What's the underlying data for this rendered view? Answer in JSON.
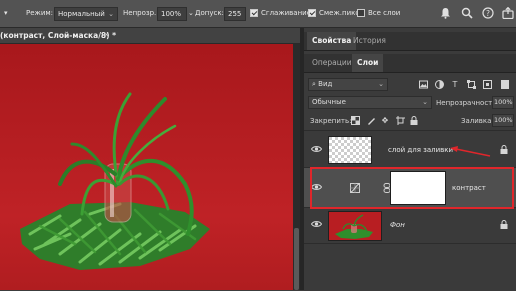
{
  "options_bar": {
    "mode_label": "Режим:",
    "mode_value": "Нормальный",
    "opacity_label": "Непрозр.:",
    "opacity_value": "100%",
    "tolerance_label": "Допуск:",
    "tolerance_value": "255",
    "antialias_label": "Сглаживание",
    "antialias_checked": true,
    "contiguous_label": "Смеж.пикс",
    "contiguous_checked": true,
    "all_layers_label": "Все слои",
    "all_layers_checked": false,
    "icons": [
      "bell-icon",
      "search-icon",
      "help-icon",
      "share-icon"
    ]
  },
  "document": {
    "tab_title": "(контраст, Слой-маска/8) *",
    "close_glyph": "×"
  },
  "panel_top": {
    "tabs": [
      "Свойства",
      "История"
    ],
    "active_tab": "Свойства"
  },
  "layers_panel": {
    "tabs": [
      "Операции",
      "Слои"
    ],
    "active_tab": "Слои",
    "filter_value": "Вид",
    "blend_mode": "Обычные",
    "opacity_label": "Непрозрачность:",
    "opacity_value": "100%",
    "lock_label": "Закрепить:",
    "fill_label": "Заливка:",
    "fill_value": "100%",
    "layers": [
      {
        "name": "слой для заливки",
        "visible": true,
        "locked": true,
        "italic": false
      },
      {
        "name": "контраст",
        "visible": true,
        "locked": false,
        "italic": false,
        "selected": true,
        "highlight_color": "#e0262b"
      },
      {
        "name": "Фон",
        "visible": true,
        "locked": true,
        "italic": true
      }
    ],
    "annotation_arrow_color": "#e0262b"
  },
  "colors": {
    "canvas_red": "#b81e22",
    "highlight_red": "#e0262b"
  }
}
